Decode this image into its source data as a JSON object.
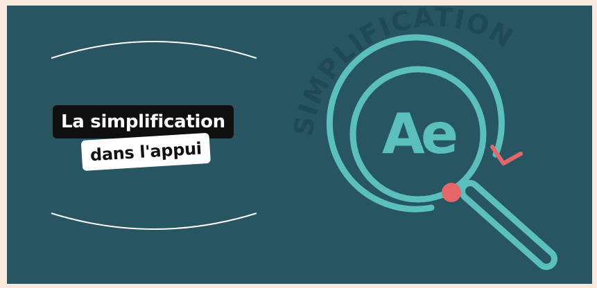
{
  "headline": {
    "line1": "La simplification",
    "line2": "dans l'appui"
  },
  "logo": {
    "monogram": "Ae",
    "curved_text": "SIMPLIFICATION",
    "icon": "magnifier-icon"
  },
  "colors": {
    "background": "#275562",
    "frame": "#fbe9de",
    "teal": "#5bc0bb",
    "coral": "#e4686a",
    "curved_text": "#1f4a55"
  }
}
